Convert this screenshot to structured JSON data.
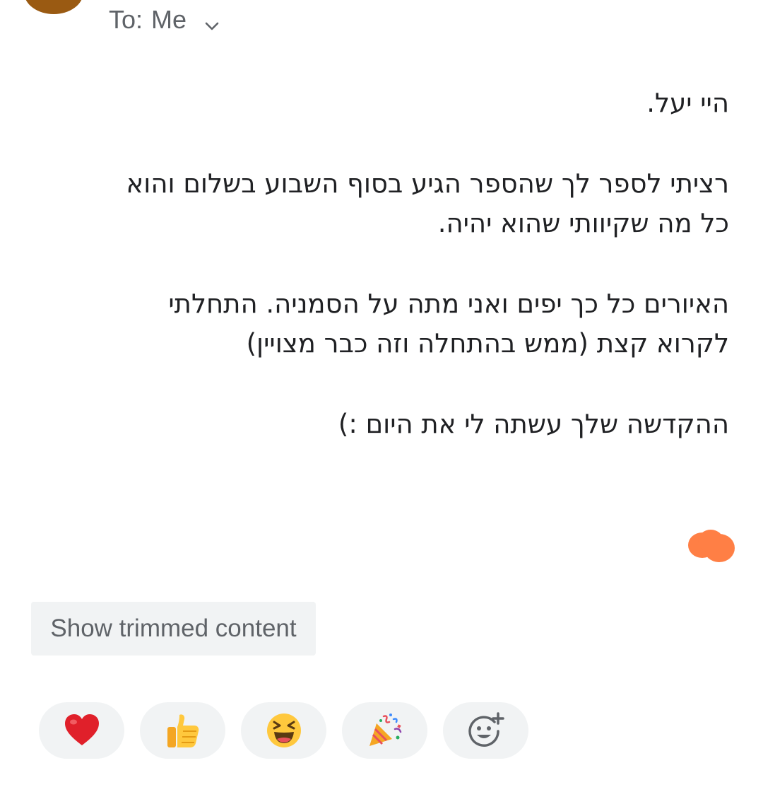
{
  "header": {
    "to_label": "To:",
    "recipient": "Me"
  },
  "message": {
    "paragraphs": [
      [
        "היי יעל."
      ],
      [
        "רציתי לספר לך שהספר הגיע בסוף השבוע בשלום והוא",
        "כל מה שקיוותי שהוא יהיה."
      ],
      [
        "האיורים כל כך יפים ואני מתה על הסמניה. התחלתי",
        "לקרוא קצת (ממש בהתחלה וזה כבר מצויין)"
      ],
      [
        "ההקדשה שלך עשתה לי את היום :)"
      ]
    ]
  },
  "trimmed": {
    "label": "Show trimmed content"
  },
  "reactions": [
    {
      "icon": "heart-icon"
    },
    {
      "icon": "thumbs-up-icon"
    },
    {
      "icon": "laughing-face-icon"
    },
    {
      "icon": "party-popper-icon"
    },
    {
      "icon": "add-reaction-icon"
    }
  ],
  "colors": {
    "accent_signature_blob": "#ff7f45",
    "avatar": "#9a5a12",
    "chip_background": "#f1f3f4",
    "secondary_text": "#5f6368"
  }
}
